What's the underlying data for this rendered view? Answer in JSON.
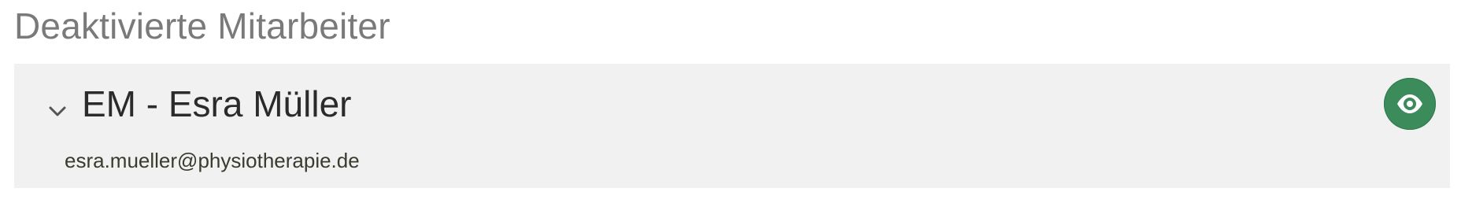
{
  "section": {
    "title": "Deaktivierte Mitarbeiter"
  },
  "employee": {
    "name": "EM - Esra Müller",
    "email": "esra.mueller@physiotherapie.de"
  },
  "icons": {
    "expand": "chevron-down-icon",
    "view": "eye-icon"
  },
  "colors": {
    "card_background": "#f1f1f1",
    "view_button": "#3b8b5b",
    "title_gray": "#7a7a7a"
  }
}
